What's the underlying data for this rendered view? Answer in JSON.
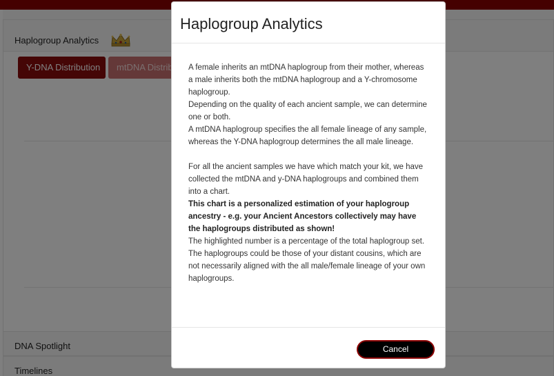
{
  "page": {
    "cards": {
      "haplogroup": {
        "title": "Haplogroup Analytics",
        "icon": "crown-icon"
      },
      "dna_spotlight": {
        "title": "DNA Spotlight"
      },
      "timelines": {
        "title": "Timelines"
      }
    },
    "tabs": [
      {
        "label": "Y-DNA Distribution",
        "active": true
      },
      {
        "label": "mtDNA Distribution",
        "active": false
      }
    ]
  },
  "modal": {
    "title": "Haplogroup Analytics",
    "paragraphs": [
      "A female inherits an mtDNA haplogroup from their mother, whereas a male inherits both the mtDNA haplogroup and a Y-chromosome haplogroup.",
      "Depending on the quality of each ancient sample, we can determine one or both.",
      "A mtDNA haplogroup specifies the all female lineage of any sample, whereas the Y-DNA haplogroup determines the all male lineage.",
      "For all the ancient samples we have which match your kit, we have collected the mtDNA and y-DNA haplogroups and combined them into a chart.",
      "This chart is a personalized estimation of your haplogroup ancestry - e.g. your Ancient Ancestors collectively may have the haplogroups distributed as shown!",
      "The highlighted number is a percentage of the total haplogroup set.",
      "The haplogroups could be those of your distant cousins, which are not necessarily aligned with the all male/female lineage of your own haplogroups."
    ],
    "cancel_label": "Cancel"
  },
  "colors": {
    "brand": "#8b0000",
    "tab_active": "#8b0d0d",
    "tab_inactive": "#c97070",
    "button_bg": "#000000"
  }
}
